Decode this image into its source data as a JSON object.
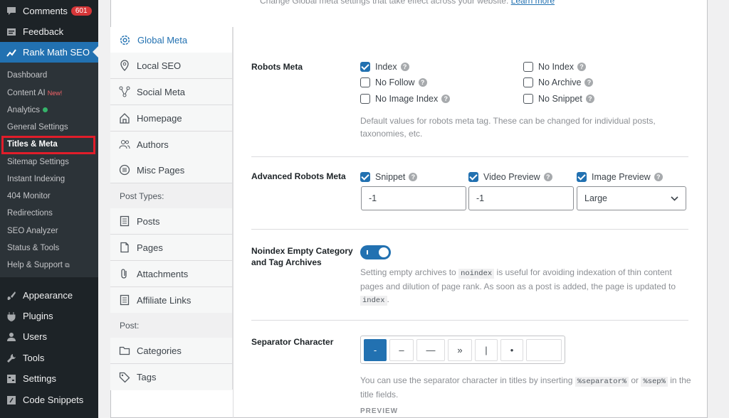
{
  "wp_menu": {
    "top": [
      {
        "label": "Comments",
        "badge": "601",
        "icon": "comment-icon"
      },
      {
        "label": "Feedback",
        "icon": "feedback-icon"
      },
      {
        "label": "Rank Math SEO",
        "icon": "rank-math-icon"
      }
    ],
    "rank_math_submenu": [
      {
        "label": "Dashboard"
      },
      {
        "label": "Content AI",
        "tag": "New!"
      },
      {
        "label": "Analytics"
      },
      {
        "label": "General Settings"
      },
      {
        "label": "Titles & Meta",
        "current": true
      },
      {
        "label": "Sitemap Settings"
      },
      {
        "label": "Instant Indexing"
      },
      {
        "label": "404 Monitor"
      },
      {
        "label": "Redirections"
      },
      {
        "label": "SEO Analyzer"
      },
      {
        "label": "Status & Tools"
      },
      {
        "label": "Help & Support"
      }
    ],
    "bottom": [
      {
        "label": "Appearance",
        "icon": "brush-icon"
      },
      {
        "label": "Plugins",
        "icon": "plug-icon"
      },
      {
        "label": "Users",
        "icon": "user-icon"
      },
      {
        "label": "Tools",
        "icon": "wrench-icon"
      },
      {
        "label": "Settings",
        "icon": "settings-icon"
      },
      {
        "label": "Code Snippets",
        "icon": "code-icon"
      }
    ]
  },
  "top_note": {
    "text": "Change Global meta settings that take effect across your website.",
    "link": "Learn more"
  },
  "tabs": {
    "global_meta": "Global Meta",
    "local_seo": "Local SEO",
    "social_meta": "Social Meta",
    "homepage": "Homepage",
    "authors": "Authors",
    "misc_pages": "Misc Pages",
    "post_types_heading": "Post Types:",
    "posts": "Posts",
    "pages": "Pages",
    "attachments": "Attachments",
    "affiliate_links": "Affiliate Links",
    "post_heading": "Post:",
    "categories": "Categories",
    "tags": "Tags"
  },
  "robots_meta": {
    "label": "Robots Meta",
    "options": {
      "index": {
        "label": "Index",
        "checked": true
      },
      "no_follow": {
        "label": "No Follow",
        "checked": false
      },
      "no_image_index": {
        "label": "No Image Index",
        "checked": false
      },
      "no_index": {
        "label": "No Index",
        "checked": false
      },
      "no_archive": {
        "label": "No Archive",
        "checked": false
      },
      "no_snippet": {
        "label": "No Snippet",
        "checked": false
      }
    },
    "description": "Default values for robots meta tag. These can be changed for individual posts, taxonomies, etc."
  },
  "advanced_robots": {
    "label": "Advanced Robots Meta",
    "snippet": {
      "label": "Snippet",
      "checked": true,
      "value": "-1"
    },
    "video_preview": {
      "label": "Video Preview",
      "checked": true,
      "value": "-1"
    },
    "image_preview": {
      "label": "Image Preview",
      "checked": true,
      "value": "Large"
    }
  },
  "noindex_empty": {
    "label_line1": "Noindex Empty Category",
    "label_line2": "and Tag Archives",
    "enabled": true,
    "desc_1": "Setting empty archives to ",
    "code_1": "noindex",
    "desc_2": " is useful for avoiding indexation of thin content pages and dilution of page rank. As soon as a post is added, the page is updated to ",
    "code_2": "index",
    "desc_3": "."
  },
  "separator": {
    "label": "Separator Character",
    "options": [
      "-",
      "–",
      "—",
      "»",
      "|",
      "•",
      ""
    ],
    "selected": "-",
    "desc_1": "You can use the separator character in titles by inserting ",
    "code_1": "%separator%",
    "desc_2": " or ",
    "code_2": "%sep%",
    "desc_3": " in the title fields.",
    "preview_label": "PREVIEW"
  },
  "colors": {
    "accent": "#2271b1",
    "sidebar": "#1d2327",
    "highlight": "#e11d2a"
  }
}
